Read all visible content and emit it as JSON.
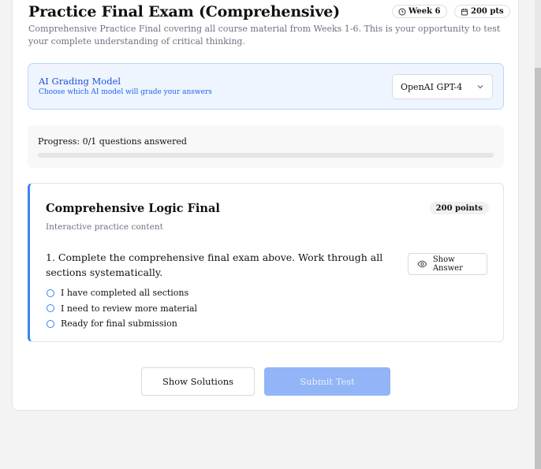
{
  "header": {
    "title": "Practice Final Exam (Comprehensive)",
    "week_badge": "Week 6",
    "points_badge": "200 pts",
    "description": "Comprehensive Practice Final covering all course material from Weeks 1-6. This is your opportunity to test your complete understanding of critical thinking."
  },
  "ai_grading": {
    "title": "AI Grading Model",
    "subtitle": "Choose which AI model will grade your answers",
    "selected_model": "OpenAI GPT-4"
  },
  "progress": {
    "text": "Progress: 0/1 questions answered",
    "fraction": 0
  },
  "question_card": {
    "title": "Comprehensive Logic Final",
    "points": "200 points",
    "subtitle": "Interactive practice content",
    "question": "1. Complete the comprehensive final exam above. Work through all sections systematically.",
    "show_answer_label": "Show Answer",
    "options": [
      "I have completed all sections",
      "I need to review more material",
      "Ready for final submission"
    ]
  },
  "actions": {
    "show_solutions_label": "Show Solutions",
    "submit_label": "Submit Test"
  },
  "colors": {
    "accent": "#3b82f6",
    "submit_disabled": "#93b4f6"
  }
}
